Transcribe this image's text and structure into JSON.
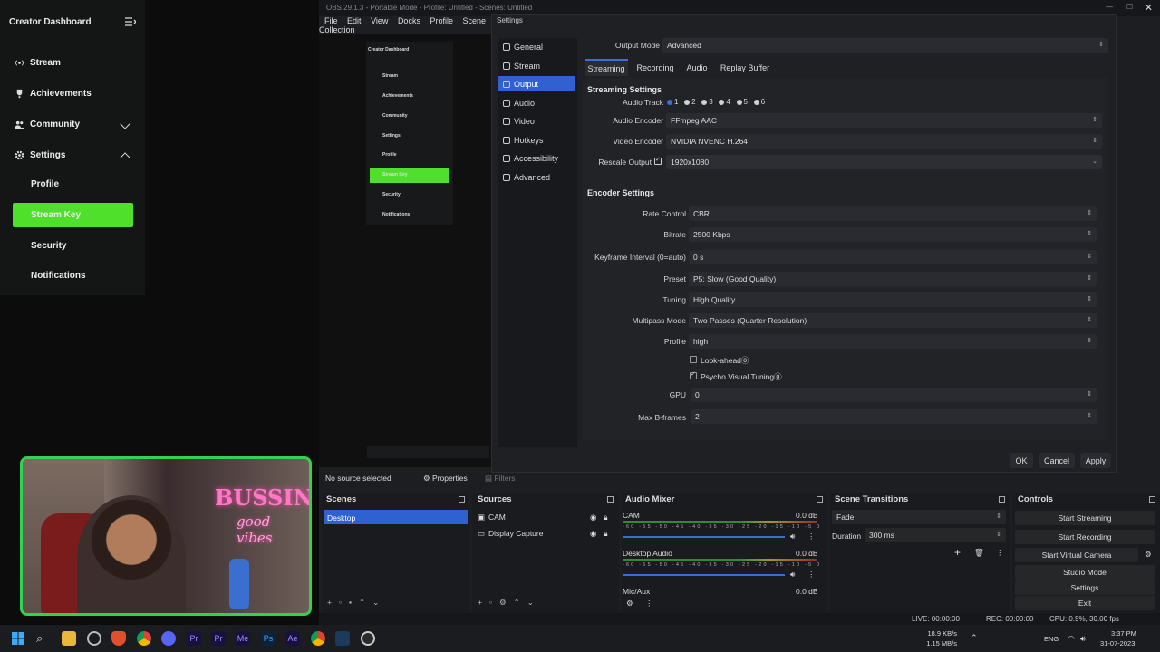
{
  "dashboard": {
    "title": "Creator Dashboard",
    "items": [
      "Stream",
      "Achievements",
      "Community",
      "Settings"
    ],
    "subitems": [
      "Profile",
      "Stream Key",
      "Security",
      "Notifications"
    ],
    "active_color": "#4ee02a"
  },
  "obs": {
    "title": "OBS 29.1.3 - Portable Mode - Profile: Untitled - Scenes: Untitled",
    "menu": [
      "File",
      "Edit",
      "View",
      "Docks",
      "Profile",
      "Scene Collection"
    ],
    "status": {
      "live": "LIVE: 00:00:00",
      "rec": "REC: 00:00:00",
      "cpu": "CPU: 0.9%, 30.00 fps"
    }
  },
  "settings": {
    "title": "Settings",
    "nav": [
      "General",
      "Stream",
      "Output",
      "Audio",
      "Video",
      "Hotkeys",
      "Accessibility",
      "Advanced"
    ],
    "nav_selected": "Output",
    "output_mode_label": "Output Mode",
    "output_mode": "Advanced",
    "tabs": [
      "Streaming",
      "Recording",
      "Audio",
      "Replay Buffer"
    ],
    "streaming_settings": "Streaming Settings",
    "audio_track_label": "Audio Track",
    "audio_tracks": [
      "1",
      "2",
      "3",
      "4",
      "5",
      "6"
    ],
    "audio_encoder_label": "Audio Encoder",
    "audio_encoder": "FFmpeg AAC",
    "video_encoder_label": "Video Encoder",
    "video_encoder": "NVIDIA NVENC H.264",
    "rescale_label": "Rescale Output",
    "rescale_value": "1920x1080",
    "encoder_settings": "Encoder Settings",
    "rate_control_label": "Rate Control",
    "rate_control": "CBR",
    "bitrate_label": "Bitrate",
    "bitrate": "2500 Kbps",
    "keyframe_label": "Keyframe Interval (0=auto)",
    "keyframe": "0 s",
    "preset_label": "Preset",
    "preset": "P5: Slow (Good Quality)",
    "tuning_label": "Tuning",
    "tuning": "High Quality",
    "multipass_label": "Multipass Mode",
    "multipass": "Two Passes (Quarter Resolution)",
    "profile_label": "Profile",
    "profile": "high",
    "lookahead": "Look-ahead⓪",
    "psycho": "Psycho Visual Tuning⓪",
    "gpu_label": "GPU",
    "gpu": "0",
    "bframes_label": "Max B-frames",
    "bframes": "2",
    "ok": "OK",
    "cancel": "Cancel",
    "apply": "Apply"
  },
  "docks": {
    "no_source": "No source selected",
    "properties": "Properties",
    "filters": "Filters",
    "scenes": "Scenes",
    "scene_items": [
      "Desktop"
    ],
    "sources": "Sources",
    "source_items": [
      "CAM",
      "Display Capture"
    ],
    "mixer": "Audio Mixer",
    "channels": [
      {
        "name": "CAM",
        "db": "0.0 dB"
      },
      {
        "name": "Desktop Audio",
        "db": "0.0 dB"
      },
      {
        "name": "Mic/Aux",
        "db": "0.0 dB"
      }
    ],
    "meter_scale": "-60 -55 -50 -45 -40 -35 -30 -25 -20 -15 -10 -5 0",
    "transitions": "Scene Transitions",
    "transition": "Fade",
    "duration_label": "Duration",
    "duration": "300 ms",
    "controls": "Controls",
    "control_buttons": [
      "Start Streaming",
      "Start Recording",
      "Start Virtual Camera",
      "Studio Mode",
      "Settings",
      "Exit"
    ]
  },
  "webcam": {
    "neon_top": "BUSSIN'",
    "neon_bottom": "good vibes"
  },
  "taskbar": {
    "net_up": "18.9 KB/s",
    "net_down": "1.15 MB/s",
    "lang": "ENG",
    "time": "3:37 PM",
    "date": "31-07-2023"
  }
}
